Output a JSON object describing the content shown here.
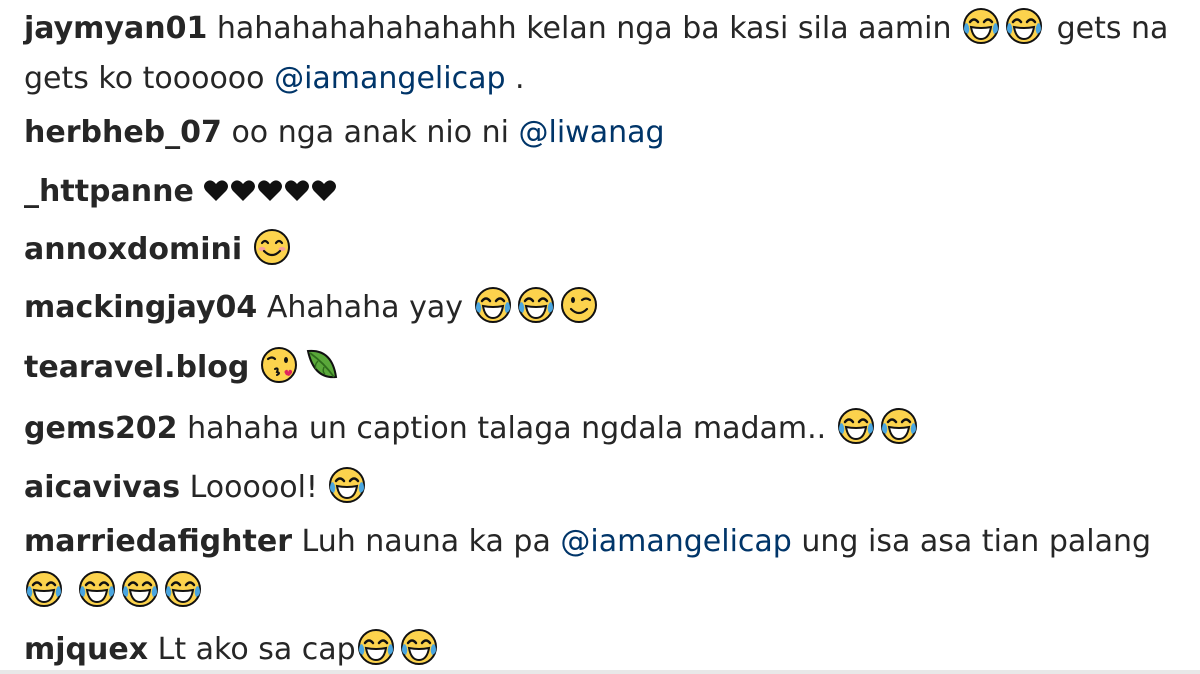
{
  "comments": [
    {
      "username": "jaymyan01",
      "text_a": "hahahahahahahahh kelan nga ba kasi sila aamin",
      "text_b": "gets na gets ko toooooo",
      "mention": "@iamangelicap",
      "text_c": "."
    },
    {
      "username": "herbheb_07",
      "text": "oo nga anak nio ni",
      "mention": "@liwanag"
    },
    {
      "username": "_httpanne",
      "emojis": [
        "black-heart",
        "black-heart",
        "black-heart",
        "black-heart",
        "black-heart"
      ]
    },
    {
      "username": "annoxdomini",
      "emojis": [
        "smiling-face"
      ]
    },
    {
      "username": "mackingjay04",
      "text": "Ahahaha yay",
      "emojis": [
        "tears-of-joy",
        "tears-of-joy",
        "winking-face"
      ]
    },
    {
      "username": "tearavel.blog",
      "emojis": [
        "face-blowing-kiss",
        "leaf"
      ]
    },
    {
      "username": "gems202",
      "text": "hahaha un caption talaga ngdala madam..",
      "emojis": [
        "tears-of-joy",
        "tears-of-joy"
      ]
    },
    {
      "username": "aicavivas",
      "text": "Loooool!",
      "emojis": [
        "tears-of-joy"
      ]
    },
    {
      "username": "marriedafighter",
      "text_a": "Luh nauna ka pa",
      "mention": "@iamangelicap",
      "text_b": "ung isa asa tian palang"
    },
    {
      "username": "mjquex",
      "text": "Lt ako sa cap"
    }
  ],
  "colors": {
    "username": "#262626",
    "text": "#262626",
    "mention": "#003569",
    "emoji_yellow": "#fcd34d",
    "tear_blue": "#4aa6e0",
    "heart": "#111111"
  }
}
